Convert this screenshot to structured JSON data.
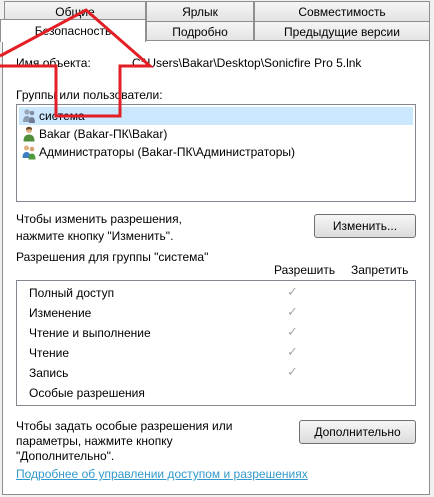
{
  "tabs": {
    "row_top": [
      "Общие",
      "Ярлык",
      "Совместимость"
    ],
    "row_bottom": [
      "Безопасность",
      "Подробно",
      "Предыдущие версии"
    ]
  },
  "object": {
    "label": "Имя объекта:",
    "path": "C:\\Users\\Bakar\\Desktop\\Sonicfire Pro 5.lnk"
  },
  "groups": {
    "label": "Группы или пользователи:",
    "items": [
      "система",
      "Bakar (Bakar-ПК\\Bakar)",
      "Администраторы (Bakar-ПК\\Администраторы)"
    ]
  },
  "change": {
    "hint_line1": "Чтобы изменить разрешения,",
    "hint_line2": "нажмите кнопку \"Изменить\".",
    "button": "Изменить..."
  },
  "permissions": {
    "label": "Разрешения для группы \"система\"",
    "allow_header": "Разрешить",
    "deny_header": "Запретить",
    "rows": [
      {
        "name": "Полный доступ",
        "allow": true
      },
      {
        "name": "Изменение",
        "allow": true
      },
      {
        "name": "Чтение и выполнение",
        "allow": true
      },
      {
        "name": "Чтение",
        "allow": true
      },
      {
        "name": "Запись",
        "allow": true
      },
      {
        "name": "Особые разрешения",
        "allow": false
      }
    ],
    "check_glyph": "✓"
  },
  "advanced": {
    "hint_line1": "Чтобы задать особые разрешения или",
    "hint_line2": "параметры, нажмите кнопку",
    "hint_line3": "\"Дополнительно\".",
    "button": "Дополнительно"
  },
  "footer": {
    "link": "Подробнее об управлении доступом и разрешениях"
  },
  "colors": {
    "annotation_arrow": "#e31e24",
    "link": "#3399cc",
    "selection": "#cce8ff"
  }
}
